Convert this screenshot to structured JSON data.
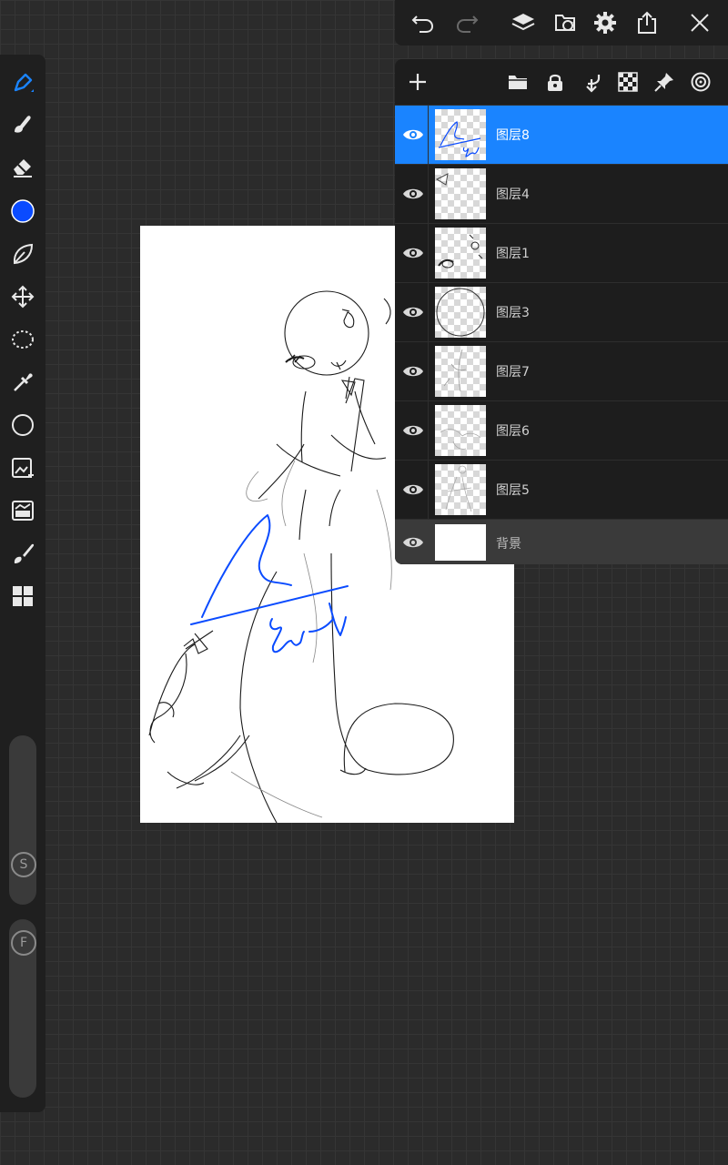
{
  "toolbar_left": {
    "tools": [
      "pen-icon",
      "smudge-icon",
      "eraser-icon",
      "color-swatch",
      "lasso-fill-icon",
      "transform-icon",
      "selection-icon",
      "eyedropper-icon",
      "circle-shape-icon",
      "image-import-icon",
      "filter-icon",
      "brush-icon",
      "grid-panels-icon"
    ],
    "active_tool": "pen-icon",
    "current_color": "#0a4bff",
    "size_slider_label": "S",
    "opacity_slider_label": "F"
  },
  "toolbar_top": {
    "buttons": [
      "undo-icon",
      "redo-icon",
      "layers-icon",
      "file-swap-icon",
      "settings-gear-icon",
      "share-icon",
      "close-icon"
    ]
  },
  "layers_panel": {
    "header_buttons": [
      "add-layer-icon",
      "folder-icon",
      "lock-icon",
      "clip-arrow-icon",
      "transparency-checker-icon",
      "pin-icon",
      "blend-target-icon"
    ],
    "layers": [
      {
        "name": "图层8",
        "selected": true,
        "visible": true
      },
      {
        "name": "图层4",
        "selected": false,
        "visible": true
      },
      {
        "name": "图层1",
        "selected": false,
        "visible": true
      },
      {
        "name": "图层3",
        "selected": false,
        "visible": true
      },
      {
        "name": "图层7",
        "selected": false,
        "visible": true
      },
      {
        "name": "图层6",
        "selected": false,
        "visible": true
      },
      {
        "name": "图层5",
        "selected": false,
        "visible": true
      }
    ],
    "background_layer": {
      "name": "背景",
      "visible": true
    }
  },
  "colors": {
    "accent": "#1a84ff",
    "panel": "#1d1d1d",
    "stroke_blue": "#0a4bff"
  }
}
